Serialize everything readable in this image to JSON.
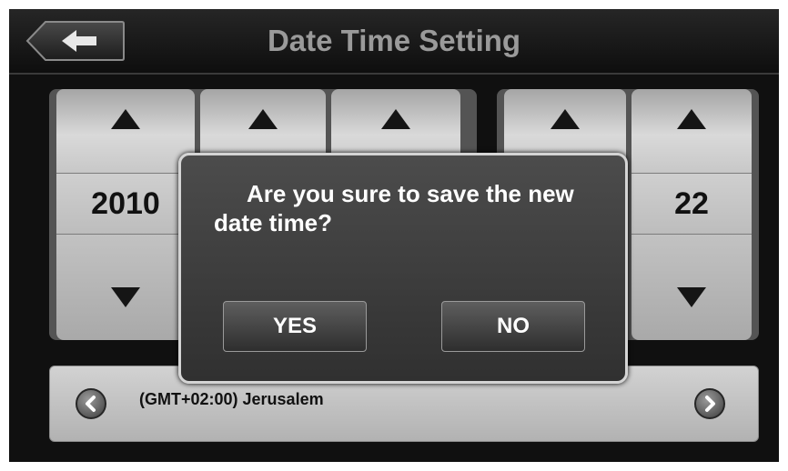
{
  "header": {
    "title": "Date Time Setting",
    "back_icon": "arrow-left-icon"
  },
  "pickers": {
    "columns": [
      {
        "value": "2010"
      },
      {
        "value": ""
      },
      {
        "value": ""
      },
      {
        "value": ""
      },
      {
        "value": "22"
      }
    ]
  },
  "timezone": {
    "label": "(GMT+02:00) Jerusalem",
    "prev_icon": "chevron-left-circle-icon",
    "next_icon": "chevron-right-circle-icon"
  },
  "dialog": {
    "message": "Are you sure to save the new date time?",
    "yes_label": "YES",
    "no_label": "NO"
  },
  "colors": {
    "background": "#101010",
    "panel": "#545454",
    "dialog_border": "#d4d4d4",
    "title_text": "#9a9a9a"
  }
}
